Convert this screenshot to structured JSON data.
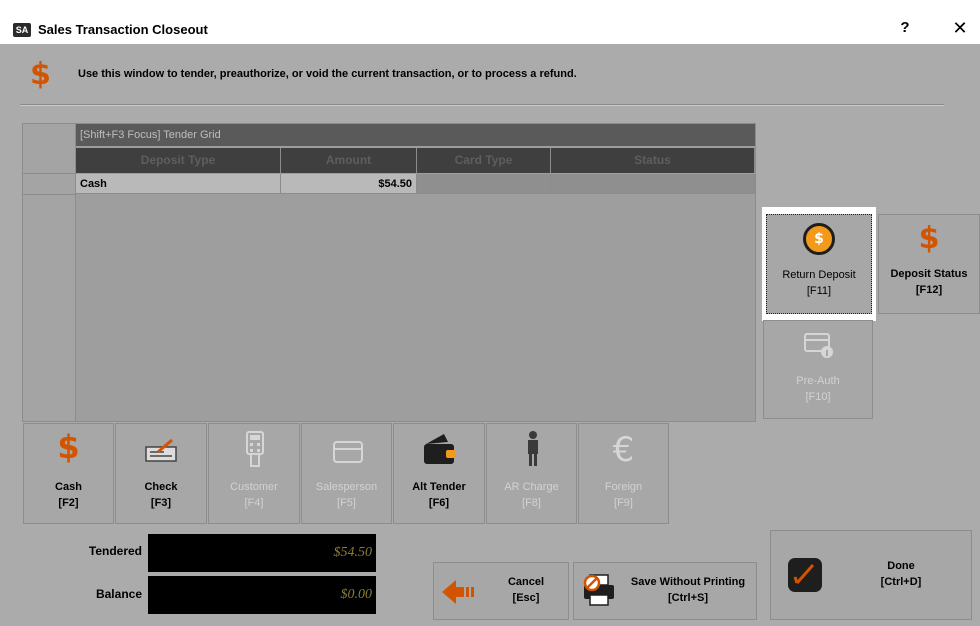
{
  "window": {
    "app_badge": "SA",
    "title": "Sales Transaction Closeout",
    "help_label": "?",
    "close_label": "✕"
  },
  "header": {
    "icon": "dollar-icon",
    "instructions": "Use this window to tender, preauthorize, or void the current transaction, or to process a refund."
  },
  "grid": {
    "caption": "[Shift+F3 Focus] Tender Grid",
    "columns": [
      "Deposit Type",
      "Amount",
      "Card Type",
      "Status"
    ],
    "rows": [
      {
        "deposit_type": "Cash",
        "amount": "$54.50",
        "card_type": "",
        "status": ""
      }
    ]
  },
  "side_buttons": {
    "return_deposit": {
      "label": "Return Deposit",
      "key": "[F11]"
    },
    "deposit_status": {
      "label": "Deposit Status",
      "key": "[F12]"
    },
    "pre_auth": {
      "label": "Pre-Auth",
      "key": "[F10]"
    }
  },
  "tender_buttons": [
    {
      "label": "Cash",
      "key": "[F2]",
      "icon": "dollar-icon"
    },
    {
      "label": "Check",
      "key": "[F3]",
      "icon": "check-icon"
    },
    {
      "label": "Customer",
      "key": "[F4]",
      "icon": "card-reader-icon"
    },
    {
      "label": "Salesperson",
      "key": "[F5]",
      "icon": "card-icon"
    },
    {
      "label": "Alt Tender",
      "key": "[F6]",
      "icon": "wallet-icon"
    },
    {
      "label": "AR Charge",
      "key": "[F8]",
      "icon": "person-icon"
    },
    {
      "label": "Foreign",
      "key": "[F9]",
      "icon": "euro-icon"
    }
  ],
  "totals": {
    "tendered_label": "Tendered",
    "tendered_value": "$54.50",
    "balance_label": "Balance",
    "balance_value": "$0.00"
  },
  "actions": {
    "cancel": {
      "label": "Cancel",
      "key": "[Esc]"
    },
    "save_without_printing": {
      "label": "Save Without Printing",
      "key": "[Ctrl+S]"
    },
    "done": {
      "label": "Done",
      "key": "[Ctrl+D]"
    }
  },
  "colors": {
    "accent": "#d35400",
    "orange": "#f39a1c"
  }
}
